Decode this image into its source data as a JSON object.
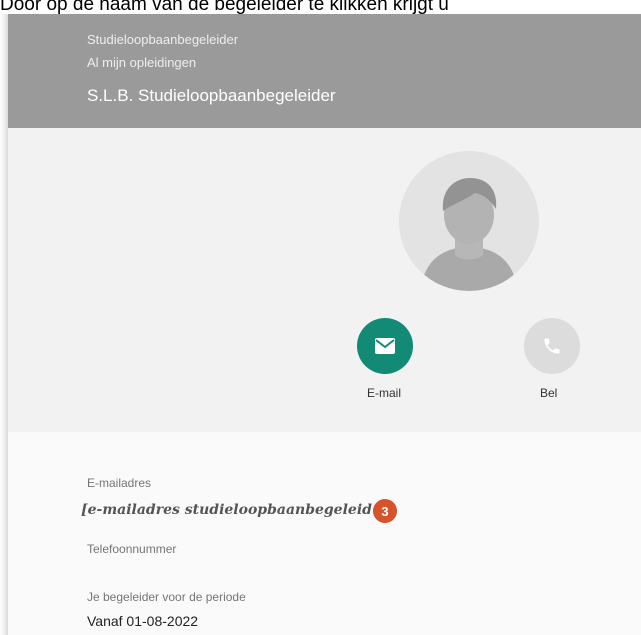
{
  "caption": "Door op de naam van de begeleider te klikken krijgt u",
  "header": {
    "crumb1": "Studieloopbaanbegeleider",
    "crumb2": "Al mijn opleidingen",
    "title": "S.L.B. Studieloopbaanbegeleider"
  },
  "profile": {
    "avatar_icon": "person-avatar-icon"
  },
  "actions": {
    "email": {
      "label": "E-mail",
      "icon": "mail-icon",
      "color": "#138a76"
    },
    "phone": {
      "label": "Bel",
      "icon": "phone-icon",
      "color": "#dcdcdc"
    }
  },
  "details": {
    "email_label": "E-mailadres",
    "email_value": "[e-mailadres studieloopbaanbegeleider]",
    "badge": "3",
    "badge_color": "#d6532b",
    "phone_label": "Telefoonnummer",
    "period_label": "Je begeleider voor de periode",
    "period_value": "Vanaf 01-08-2022"
  },
  "colors": {
    "header": "#9a9a9a",
    "background": "#f2f2f2"
  }
}
